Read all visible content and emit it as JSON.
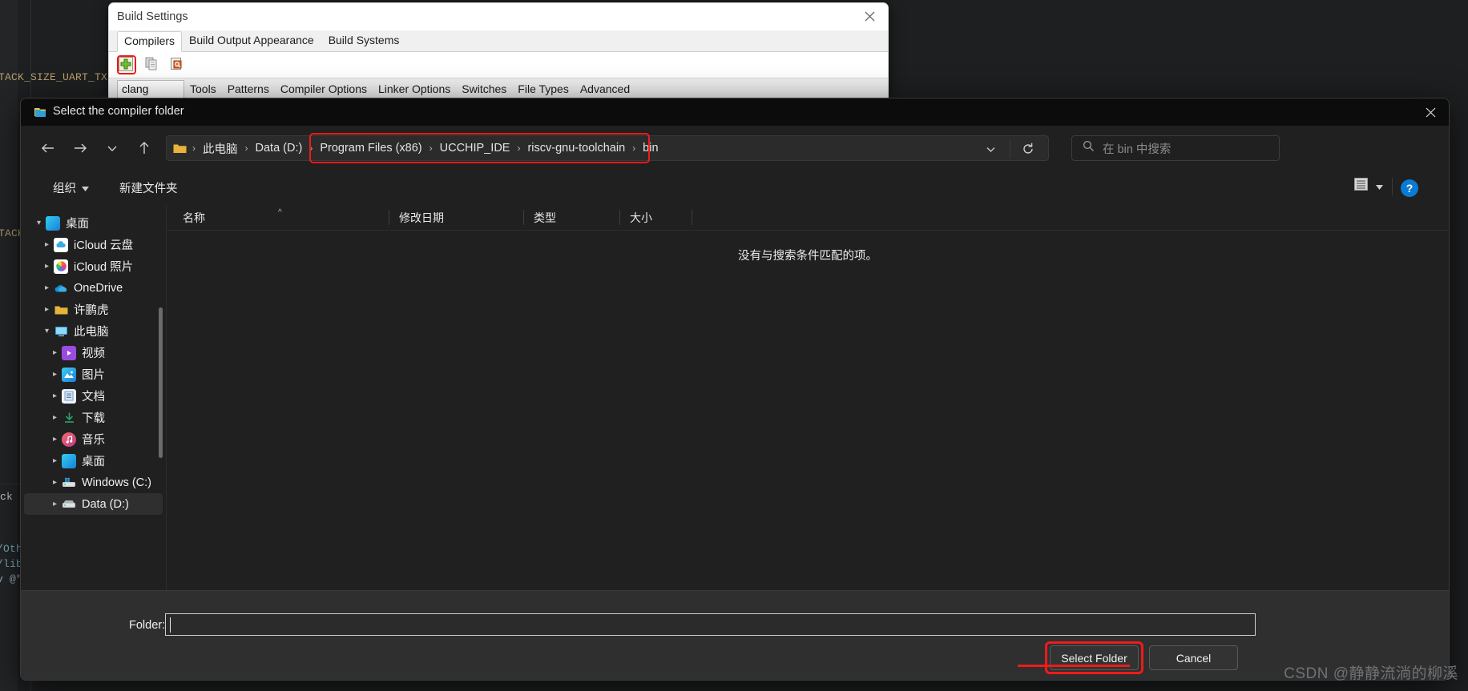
{
  "editor": {
    "code_lines": [
      "TACK_SIZE_UART_TX,",
      "TACK_",
      "ck",
      "/Oth",
      "/lib",
      "v @\""
    ]
  },
  "build_settings": {
    "title": "Build Settings",
    "close_icon": "close-icon",
    "tabs": [
      {
        "label": "Compilers",
        "active": true
      },
      {
        "label": "Build Output Appearance",
        "active": false
      },
      {
        "label": "Build Systems",
        "active": false
      }
    ],
    "toolbar": [
      {
        "name": "add-compiler-icon",
        "highlighted": true
      },
      {
        "name": "copy-compiler-icon",
        "highlighted": false
      },
      {
        "name": "inspect-compiler-icon",
        "highlighted": false
      }
    ],
    "compiler_combo_value": "clang",
    "sub_tabs": [
      "Tools",
      "Patterns",
      "Compiler Options",
      "Linker Options",
      "Switches",
      "File Types",
      "Advanced"
    ]
  },
  "file_dialog": {
    "title": "Select the compiler folder",
    "close_icon": "close-icon",
    "nav": {
      "back_icon": "arrow-left-icon",
      "forward_icon": "arrow-right-icon",
      "recent_icon": "chevron-down-icon",
      "up_icon": "arrow-up-icon",
      "refresh_icon": "refresh-icon",
      "address_chevron_icon": "chevron-down-icon"
    },
    "breadcrumb": [
      {
        "label": "此电脑",
        "highlighted": false
      },
      {
        "label": "Data (D:)",
        "highlighted": false
      },
      {
        "label": "Program Files (x86)",
        "highlighted": true
      },
      {
        "label": "UCCHIP_IDE",
        "highlighted": true
      },
      {
        "label": "riscv-gnu-toolchain",
        "highlighted": true
      },
      {
        "label": "bin",
        "highlighted": true
      }
    ],
    "search": {
      "placeholder": "在 bin 中搜索",
      "value": "",
      "icon": "search-icon"
    },
    "command_bar": {
      "organize": "组织",
      "organize_caret_icon": "caret-down-icon",
      "new_folder": "新建文件夹",
      "view_icon": "view-list-icon",
      "view_caret_icon": "caret-down-icon",
      "help_icon": "help-icon",
      "help_label": "?"
    },
    "sidebar": [
      {
        "label": "桌面",
        "level": 1,
        "expanded": true,
        "icon": "desktop-icon",
        "selected": false
      },
      {
        "label": "iCloud 云盘",
        "level": 2,
        "expanded": false,
        "icon": "icloud-drive-icon",
        "selected": false
      },
      {
        "label": "iCloud 照片",
        "level": 2,
        "expanded": false,
        "icon": "icloud-photos-icon",
        "selected": false
      },
      {
        "label": "OneDrive",
        "level": 2,
        "expanded": false,
        "icon": "onedrive-icon",
        "selected": false
      },
      {
        "label": "许鹏虎",
        "level": 2,
        "expanded": false,
        "icon": "user-folder-icon",
        "selected": false
      },
      {
        "label": "此电脑",
        "level": 2,
        "expanded": true,
        "icon": "this-pc-icon",
        "selected": false
      },
      {
        "label": "视频",
        "level": 3,
        "expanded": false,
        "icon": "videos-icon",
        "selected": false
      },
      {
        "label": "图片",
        "level": 3,
        "expanded": false,
        "icon": "pictures-icon",
        "selected": false
      },
      {
        "label": "文档",
        "level": 3,
        "expanded": false,
        "icon": "documents-icon",
        "selected": false
      },
      {
        "label": "下载",
        "level": 3,
        "expanded": false,
        "icon": "downloads-icon",
        "selected": false
      },
      {
        "label": "音乐",
        "level": 3,
        "expanded": false,
        "icon": "music-icon",
        "selected": false
      },
      {
        "label": "桌面",
        "level": 3,
        "expanded": false,
        "icon": "desktop-icon",
        "selected": false
      },
      {
        "label": "Windows (C:)",
        "level": 3,
        "expanded": false,
        "icon": "windows-drive-icon",
        "selected": false
      },
      {
        "label": "Data (D:)",
        "level": 3,
        "expanded": false,
        "icon": "drive-icon",
        "selected": true
      }
    ],
    "columns": [
      {
        "label": "名称",
        "sorted": true,
        "sort_icon": "caret-up-icon"
      },
      {
        "label": "修改日期",
        "sorted": false
      },
      {
        "label": "类型",
        "sorted": false
      },
      {
        "label": "大小",
        "sorted": false
      }
    ],
    "empty_message": "没有与搜索条件匹配的项。",
    "footer": {
      "folder_label": "Folder:",
      "folder_value": "",
      "select_button": "Select Folder",
      "cancel_button": "Cancel"
    }
  },
  "watermark": "CSDN @静静流淌的柳溪",
  "colors": {
    "accent_red": "#ee1b1b",
    "help_blue": "#0a7bd4",
    "dialog_bg": "#202020",
    "footer_bg": "#2f2f2f",
    "titlebar_bg": "#0c0c0c"
  }
}
